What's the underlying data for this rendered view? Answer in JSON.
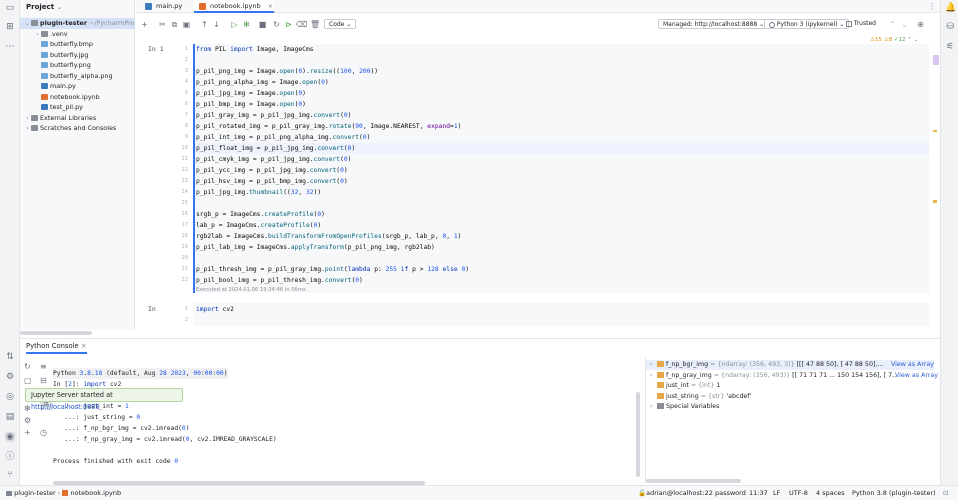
{
  "project_panel": {
    "title": "Project",
    "tree": [
      {
        "label": "plugin-tester",
        "suffix": "~/PycharmPro",
        "depth": 0,
        "expanded": true,
        "type": "folder"
      },
      {
        "label": ".venv",
        "depth": 1,
        "expanded": false,
        "type": "folder"
      },
      {
        "label": "butterfly.bmp",
        "depth": 1,
        "type": "image"
      },
      {
        "label": "butterfly.jpg",
        "depth": 1,
        "type": "image"
      },
      {
        "label": "butterfly.png",
        "depth": 1,
        "type": "image"
      },
      {
        "label": "butterfly_alpha.png",
        "depth": 1,
        "type": "image"
      },
      {
        "label": "main.py",
        "depth": 1,
        "type": "py"
      },
      {
        "label": "notebook.ipynb",
        "depth": 1,
        "type": "nb"
      },
      {
        "label": "test_pil.py",
        "depth": 1,
        "type": "py"
      },
      {
        "label": "External Libraries",
        "depth": 0,
        "expanded": false,
        "type": "lib"
      },
      {
        "label": "Scratches and Consoles",
        "depth": 0,
        "expanded": false,
        "type": "scratch"
      }
    ]
  },
  "tabs": [
    {
      "label": "main.py",
      "active": false
    },
    {
      "label": "notebook.ipynb",
      "active": true
    }
  ],
  "toolbar": {
    "cell_type": "Code",
    "server": "Managed: http://localhost:8888",
    "kernel": "Python 3 (ipykernel)",
    "trusted": "Trusted",
    "inspections": {
      "warnings": "15",
      "weak": "8",
      "typos": "12"
    }
  },
  "cell1": {
    "prompt": "In 1",
    "lines": [
      "from PIL import Image, ImageCms",
      "",
      "p_pil_png_img = Image.open(\"butterfly.png\").resize((100, 200))",
      "p_pil_png_alpha_img = Image.open(\"butterfly_alpha.png\")",
      "p_pil_jpg_img = Image.open(\"butterfly.jpg\")",
      "p_pil_bmp_img = Image.open(\"butterfly.bmp\")",
      "p_pil_gray_img = p_pil_jpg_img.convert(\"L\")",
      "p_pil_rotated_img = p_pil_gray_img.rotate(90, Image.NEAREST, expand=1)",
      "p_pil_int_img = p_pil_png_alpha_img.convert(\"I\")",
      "p_pil_float_img = p_pil_jpg_img.convert(\"F\")",
      "p_pil_cmyk_img = p_pil_jpg_img.convert(\"CMYK\")",
      "p_pil_ycc_img = p_pil_jpg_img.convert(\"YCbCr\")",
      "p_pil_hsv_img = p_pil_bmp_img.convert(\"HSV\")",
      "p_pil_jpg_img.thumbnail((32, 32))",
      "",
      "srgb_p = ImageCms.createProfile(\"sRGB\")",
      "lab_p = ImageCms.createProfile(\"LAB\")",
      "rgb2lab = ImageCms.buildTransformFromOpenProfiles(srgb_p, lab_p, \"RGB\", \"LAB\")",
      "p_pil_lab_img = ImageCms.applyTransform(p_pil_png_img, rgb2lab)",
      "",
      "p_pil_thresh_img = p_pil_gray_img.point(lambda p: 255 if p > 128 else 0)",
      "p_pil_bool_img = p_pil_thresh_img.convert('1')"
    ],
    "executed": "Executed at 2024.01.06 19:34:46 in 56ms"
  },
  "cell2": {
    "prompt": "In",
    "lines": [
      "import cv2",
      ""
    ]
  },
  "console": {
    "tab": "Python Console",
    "lines": [
      "Python 3.8.18 (default, Aug 28 2023, 00:00:00)",
      "In [2]: import cv2",
      "",
      "   ...: just_int = 1",
      "   ...: just_string = \"abcdef\"",
      "   ...: f_np_bgr_img = cv2.imread(\"butterfly.png\")",
      "   ...: f_np_gray_img = cv2.imread(\"butterfly.png\", cv2.IMREAD_GRAYSCALE)",
      "",
      "Process finished with exit code 0"
    ],
    "tooltip": {
      "text": "Jupyter Server started at ",
      "link": "http://localhost:8888"
    }
  },
  "variables": [
    {
      "name": "f_np_bgr_img",
      "type": "= {ndarray: (356, 493, 3)}",
      "value": "[[[ 47  88  50],  [ 47  88  50],...",
      "action": "View as Array",
      "expandable": true,
      "selected": true
    },
    {
      "name": "f_np_gray_img",
      "type": "= {ndarray: (356, 493)}",
      "value": "[[ 71  71  71 ... 150 154 156],  [ 7...",
      "action": "View as Array",
      "expandable": true
    },
    {
      "name": "just_int",
      "type": "= {int}",
      "value": "1",
      "action": "",
      "expandable": false
    },
    {
      "name": "just_string",
      "type": "= {str}",
      "value": "'abcdef'",
      "action": "",
      "expandable": false
    },
    {
      "name": "Special Variables",
      "type": "",
      "value": "",
      "action": "",
      "expandable": true
    }
  ],
  "statusbar": {
    "crumb1": "plugin-tester",
    "crumb2": "notebook.ipynb",
    "remote": "adrian@localhost:22 password",
    "position": "11:37",
    "line_sep": "LF",
    "encoding": "UTF-8",
    "indent": "4 spaces",
    "interpreter": "Python 3.8 (plugin-tester)"
  },
  "colors": {
    "accent": "#3574f0",
    "selection": "#d5e1f7",
    "cell_bg": "#f7f8fa"
  }
}
